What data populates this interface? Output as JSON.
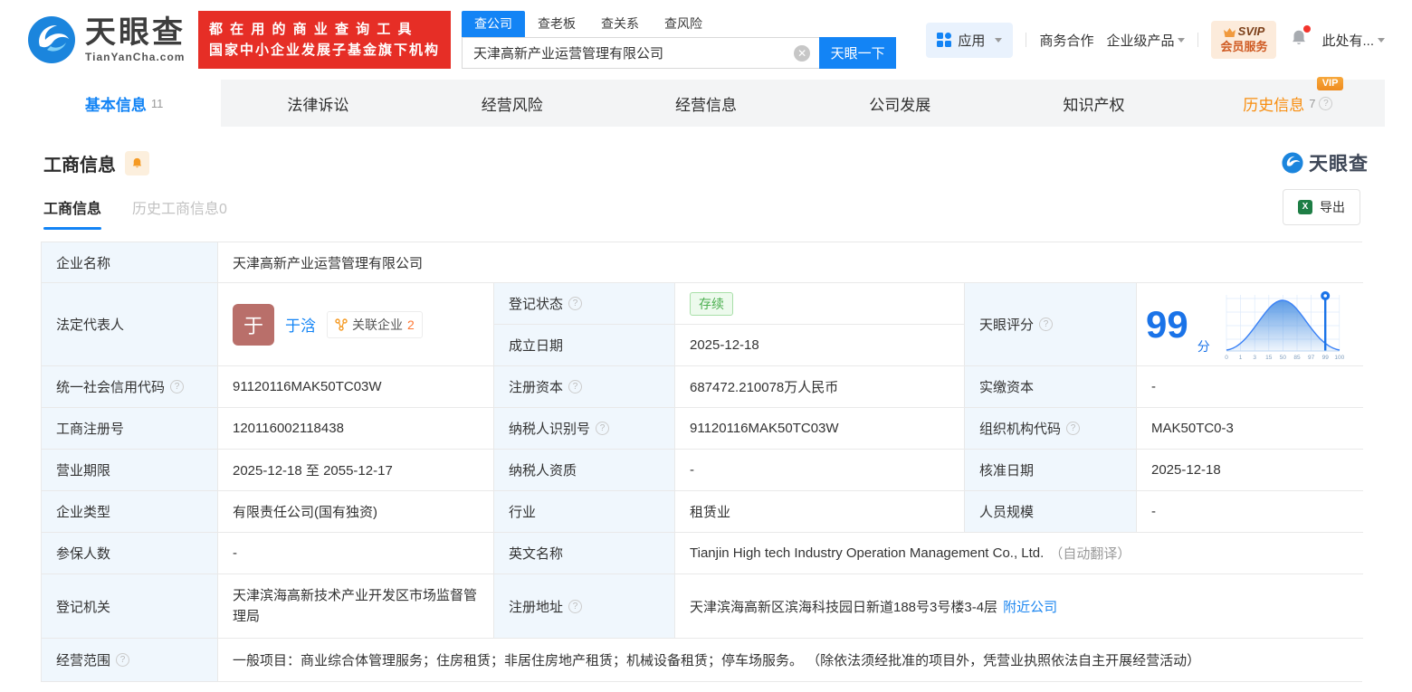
{
  "brand": {
    "logo_title": "天眼查",
    "logo_domain": "TianYanCha.com",
    "slogan_line1": "都 在 用 的 商 业 查 询 工 具",
    "slogan_line2": "国家中小企业发展子基金旗下机构",
    "watermark": "天眼查"
  },
  "search": {
    "tabs": [
      {
        "label": "查公司"
      },
      {
        "label": "查老板"
      },
      {
        "label": "查关系"
      },
      {
        "label": "查风险"
      }
    ],
    "input_value": "天津高新产业运营管理有限公司",
    "button_label": "天眼一下"
  },
  "header_nav": {
    "apps": "应用",
    "business_coop": "商务合作",
    "enterprise_products": "企业级产品",
    "svip_line1": "SVIP",
    "svip_line2": "会员服务",
    "user": "此处有..."
  },
  "tabs": [
    {
      "label": "基本信息",
      "count": "11"
    },
    {
      "label": "法律诉讼"
    },
    {
      "label": "经营风险"
    },
    {
      "label": "经营信息"
    },
    {
      "label": "公司发展"
    },
    {
      "label": "知识产权"
    },
    {
      "label": "历史信息",
      "count": "7",
      "vip_badge": "VIP"
    }
  ],
  "section": {
    "title": "工商信息",
    "subtab_active": "工商信息",
    "subtab_inactive": "历史工商信息0",
    "export_label": "导出"
  },
  "table": {
    "company_name": {
      "label": "企业名称",
      "value": "天津高新产业运营管理有限公司"
    },
    "legal_rep": {
      "label": "法定代表人",
      "avatar": "于",
      "name": "于浛",
      "badge": "关联企业",
      "badge_count": "2"
    },
    "reg_status": {
      "label": "登记状态",
      "value": "存续"
    },
    "establish_date": {
      "label": "成立日期",
      "value": "2025-12-18"
    },
    "score": {
      "label": "天眼评分",
      "value": "99",
      "unit": "分",
      "chart": {
        "type": "area",
        "ticks": [
          "0",
          "1",
          "3",
          "15",
          "50",
          "85",
          "97",
          "99",
          "100"
        ],
        "marker": "99"
      }
    },
    "credit_code": {
      "label": "统一社会信用代码",
      "value": "91120116MAK50TC03W"
    },
    "reg_capital": {
      "label": "注册资本",
      "value": "687472.210078万人民币"
    },
    "paid_capital": {
      "label": "实缴资本",
      "value": "-"
    },
    "reg_number": {
      "label": "工商注册号",
      "value": "120116002118438"
    },
    "taxpayer_id": {
      "label": "纳税人识别号",
      "value": "91120116MAK50TC03W"
    },
    "org_code": {
      "label": "组织机构代码",
      "value": "MAK50TC0-3"
    },
    "business_term": {
      "label": "营业期限",
      "value": "2025-12-18 至 2055-12-17"
    },
    "taxpayer_quality": {
      "label": "纳税人资质",
      "value": "-"
    },
    "approval_date": {
      "label": "核准日期",
      "value": "2025-12-18"
    },
    "company_type": {
      "label": "企业类型",
      "value": "有限责任公司(国有独资)"
    },
    "industry": {
      "label": "行业",
      "value": "租赁业"
    },
    "staff_size": {
      "label": "人员规模",
      "value": "-"
    },
    "insured_count": {
      "label": "参保人数",
      "value": "-"
    },
    "english_name": {
      "label": "英文名称",
      "value": "Tianjin High tech Industry Operation Management Co., Ltd.",
      "note": "（自动翻译）"
    },
    "reg_authority": {
      "label": "登记机关",
      "value": "天津滨海高新技术产业开发区市场监督管理局"
    },
    "reg_address": {
      "label": "注册地址",
      "value": "天津滨海高新区滨海科技园日新道188号3号楼3-4层",
      "link": "附近公司"
    },
    "business_scope": {
      "label": "经营范围",
      "value": "一般项目：商业综合体管理服务；住房租赁；非居住房地产租赁；机械设备租赁；停车场服务。 （除依法须经批准的项目外，凭营业执照依法自主开展经营活动）"
    }
  }
}
